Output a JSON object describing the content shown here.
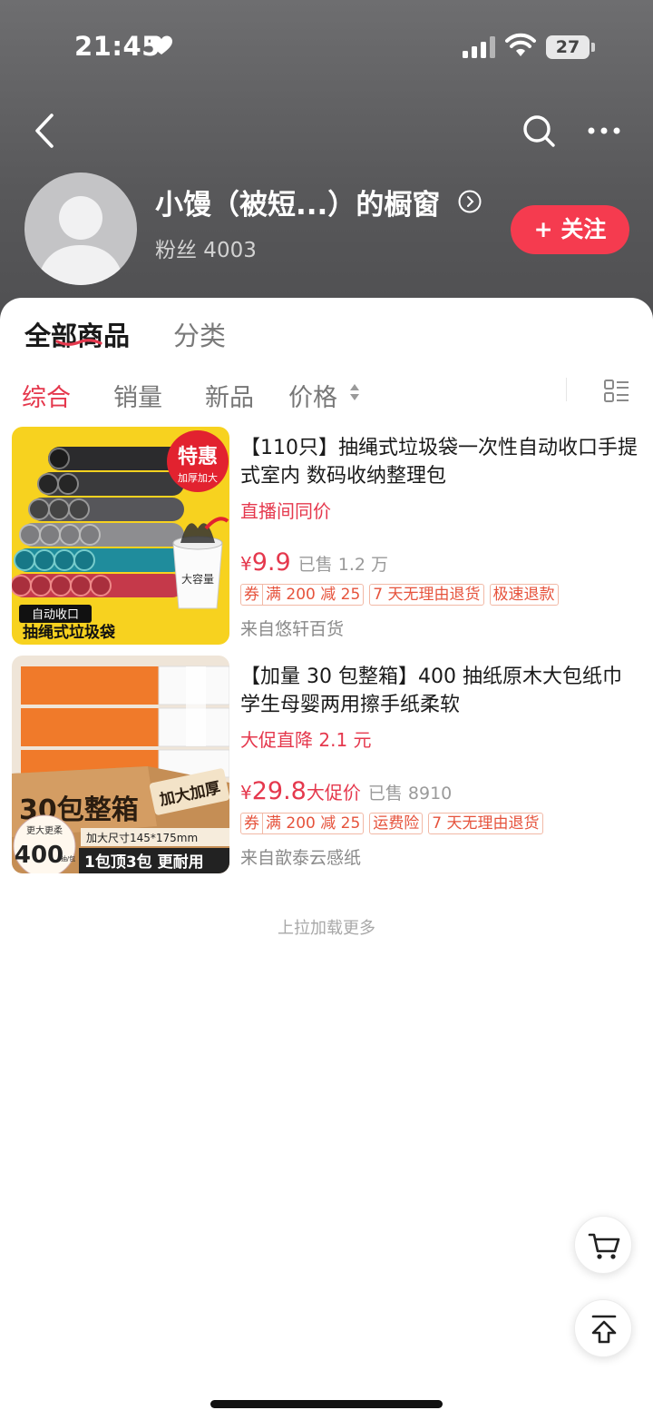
{
  "status_bar": {
    "time": "21:45",
    "battery": "27"
  },
  "shop": {
    "name": "小馒（被短...）的橱窗",
    "fans": "粉丝 4003",
    "follow_label": "+ 关注"
  },
  "tabs": [
    {
      "label": "全部商品"
    },
    {
      "label": "分类"
    }
  ],
  "sort": [
    {
      "label": "综合"
    },
    {
      "label": "销量"
    },
    {
      "label": "新品"
    },
    {
      "label": "价格"
    }
  ],
  "products": [
    {
      "title": "【110只】抽绳式垃圾袋一次性自动收口手提式室内 数码收纳整理包",
      "promo": "直播间同价",
      "price_symbol": "¥",
      "price": "9.9",
      "price_suffix": "",
      "sold": "已售 1.2 万",
      "coupon_prefix": "券",
      "tags": [
        "满 200 减 25",
        "7 天无理由退货",
        "极速退款"
      ],
      "store": "来自悠轩百货",
      "image": {
        "badge_title": "特惠",
        "badge_sub": "加厚加大",
        "bucket_label": "大容量",
        "caption_top": "自动收口",
        "caption_bottom": "抽绳式垃圾袋"
      }
    },
    {
      "title": "【加量 30 包整箱】400 抽纸原木大包纸巾学生母婴两用擦手纸柔软",
      "promo": "大促直降 2.1 元",
      "price_symbol": "¥",
      "price": "29.8",
      "price_suffix": "大促价",
      "sold": "已售 8910",
      "coupon_prefix": "券",
      "tags": [
        "满 200 减 25",
        "运费险",
        "7 天无理由退货"
      ],
      "store": "来自歆泰云感纸",
      "image": {
        "box_text": "30包整箱",
        "box_side": "加大加厚",
        "size_text": "加大尺寸145*175mm",
        "soft_text": "更大更柔",
        "big_num": "400",
        "unit_text": "抽/包",
        "slogan": "1包顶3包 更耐用"
      }
    }
  ],
  "load_more": "上拉加载更多",
  "colors": {
    "accent": "#e5384d",
    "follow": "#f53b4f",
    "header": "#5e5e60"
  },
  "icons": [
    "back-icon",
    "search-icon",
    "more-icon",
    "chevron-right-icon",
    "sort-arrows-icon",
    "list-layout-icon",
    "cart-icon",
    "back-to-top-icon"
  ]
}
